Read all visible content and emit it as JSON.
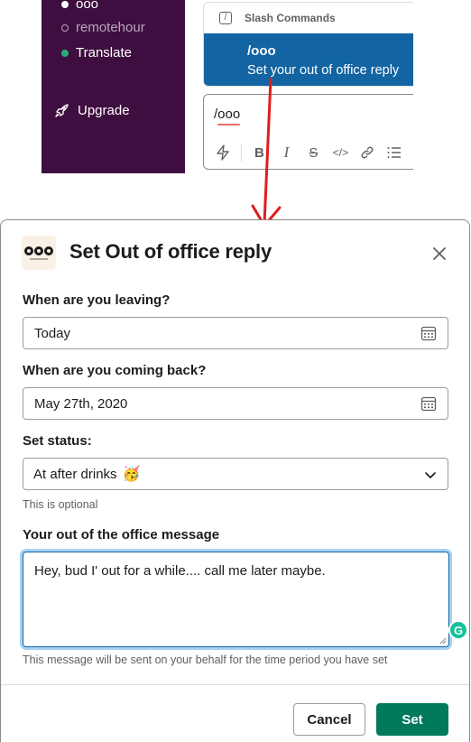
{
  "sidebar": {
    "channels": [
      {
        "label": "ooo",
        "state": "active"
      },
      {
        "label": "remotehour",
        "state": "away"
      },
      {
        "label": "Translate",
        "state": "online"
      }
    ],
    "upgrade_label": "Upgrade"
  },
  "slash_popup": {
    "header": "Slash Commands",
    "command": "/ooo",
    "description": "Set your out of office reply"
  },
  "composer": {
    "text": "/ooo",
    "toolbar_icons": [
      "shortcuts-icon",
      "bold-icon",
      "italic-icon",
      "strikethrough-icon",
      "code-icon",
      "link-icon",
      "bulleted-list-icon"
    ]
  },
  "modal": {
    "title": "Set Out of office reply",
    "leaving_label": "When are you leaving?",
    "leaving_value": "Today",
    "return_label": "When are you coming back?",
    "return_value": "May 27th, 2020",
    "status_label": "Set status:",
    "status_value": "At after drinks",
    "status_emoji": "🥳",
    "status_hint": "This is optional",
    "message_label": "Your out of the office message",
    "message_value": "Hey, bud I' out for a while.... call me later maybe.",
    "message_hint": "This message will be sent on your behalf for the time period you have set",
    "cancel_label": "Cancel",
    "set_label": "Set"
  },
  "colors": {
    "sidebar_bg": "#3f0e40",
    "highlight": "#1264a3",
    "primary_button": "#007a5a",
    "arrow": "#e01e1e"
  }
}
